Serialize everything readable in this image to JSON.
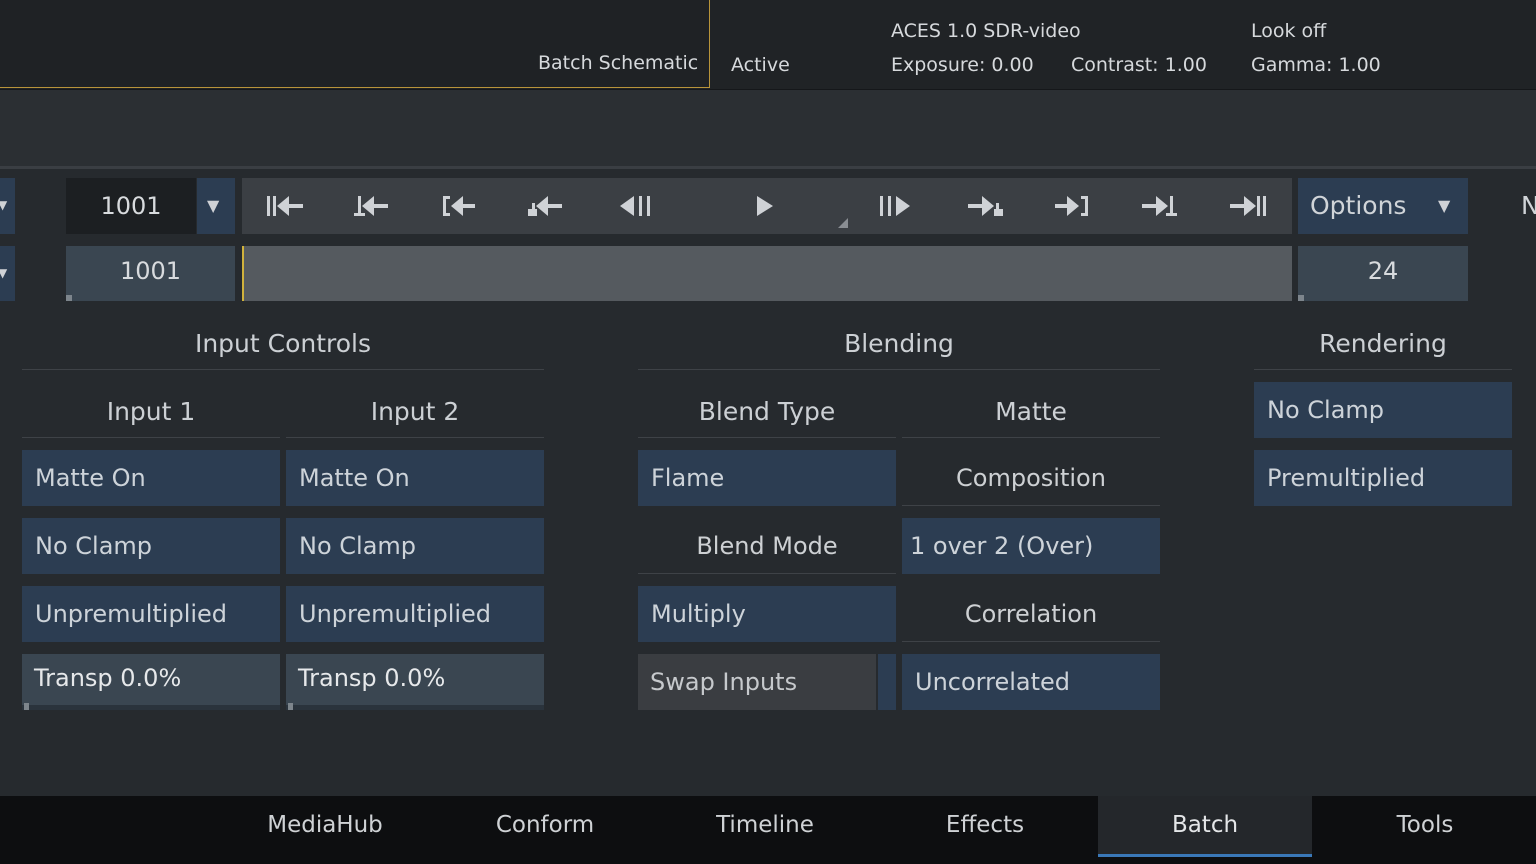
{
  "topbar": {
    "schematic_label": "Batch Schematic",
    "state": "Active",
    "colour_space": "ACES 1.0 SDR-video",
    "exposure": "Exposure: 0.00",
    "contrast": "Contrast: 1.00",
    "look": "Look off",
    "gamma": "Gamma: 1.00"
  },
  "transport": {
    "current_frame": "1001",
    "start_frame": "1001",
    "fps": "24",
    "options_label": "Options",
    "right_edge_letter": "N"
  },
  "input_controls": {
    "title": "Input Controls",
    "input1": {
      "title": "Input 1",
      "matte": "Matte On",
      "clamp": "No Clamp",
      "premult": "Unpremultiplied",
      "transp": "Transp 0.0%",
      "transp_value": 0.0
    },
    "input2": {
      "title": "Input 2",
      "matte": "Matte On",
      "clamp": "No Clamp",
      "premult": "Unpremultiplied",
      "transp": "Transp 0.0%",
      "transp_value": 0.0
    }
  },
  "blending": {
    "title": "Blending",
    "blend_type_label": "Blend Type",
    "matte_label": "Matte",
    "blend_type": "Flame",
    "composition_label": "Composition",
    "blend_mode_label": "Blend Mode",
    "composition": "1 over 2 (Over)",
    "blend_mode": "Multiply",
    "correlation_label": "Correlation",
    "swap_inputs": "Swap Inputs",
    "correlation": "Uncorrelated"
  },
  "rendering": {
    "title": "Rendering",
    "clamp": "No Clamp",
    "premult": "Premultiplied"
  },
  "tabs": [
    {
      "label": "MediaHub"
    },
    {
      "label": "Conform"
    },
    {
      "label": "Timeline"
    },
    {
      "label": "Effects"
    },
    {
      "label": "Batch",
      "active": true
    },
    {
      "label": "Tools"
    }
  ],
  "colors": {
    "accent_blue": "#3a78b8",
    "schematic_border": "#b8943a",
    "button_blue": "#2c3d52"
  }
}
